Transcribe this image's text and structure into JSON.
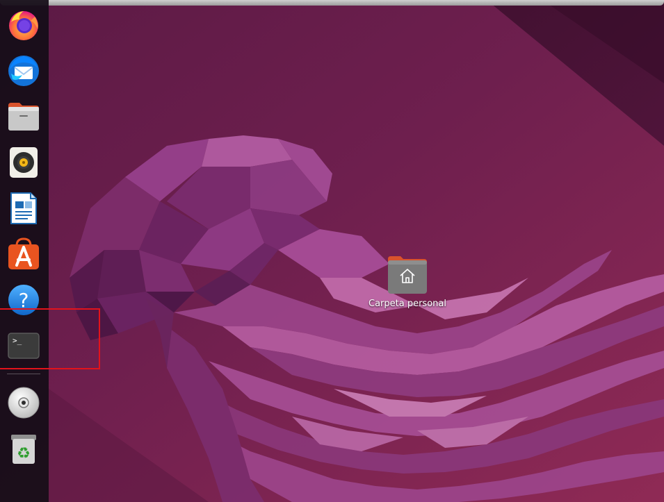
{
  "desktop": {
    "wallpaper": "Ubuntu jellyfish low-poly wallpaper",
    "colors": {
      "background_dark": "#3e0f2e",
      "background_light": "#8d2b5a",
      "accent_red": "#e3131b"
    },
    "icons": [
      {
        "label": "Carpeta personal",
        "icon": "home-folder-icon"
      }
    ]
  },
  "dock": {
    "apps": [
      {
        "id": "firefox",
        "icon": "firefox-icon"
      },
      {
        "id": "thunderbird",
        "icon": "thunderbird-icon"
      },
      {
        "id": "files",
        "icon": "files-icon"
      },
      {
        "id": "rhythmbox",
        "icon": "rhythmbox-icon"
      },
      {
        "id": "writer",
        "icon": "libreoffice-writer-icon"
      },
      {
        "id": "software",
        "icon": "ubuntu-software-icon"
      },
      {
        "id": "help",
        "icon": "help-icon",
        "glyph": "?"
      },
      {
        "id": "terminal",
        "icon": "terminal-icon",
        "glyph": ">_"
      }
    ],
    "mounts": [
      {
        "id": "disc",
        "icon": "optical-disc-icon"
      },
      {
        "id": "trash",
        "icon": "trash-icon",
        "glyph": "♻"
      }
    ],
    "highlighted_item": "terminal"
  }
}
